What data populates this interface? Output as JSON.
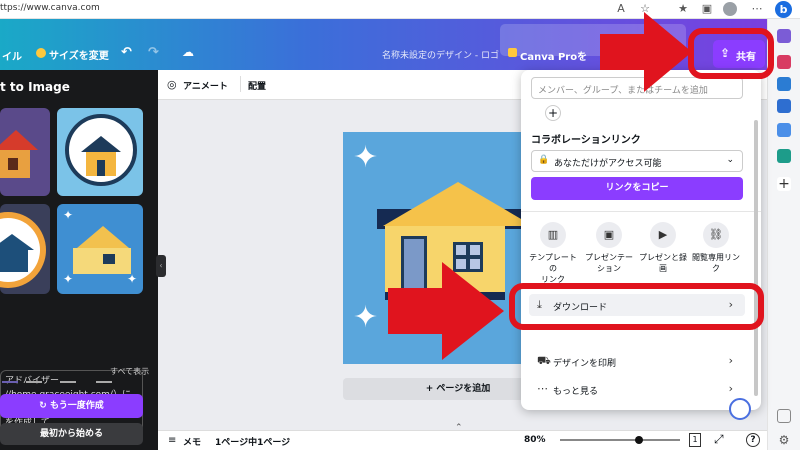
{
  "browser": {
    "url": "ttps://www.canva.com"
  },
  "header": {
    "file_label": "イル",
    "resize_label": "サイズを変更",
    "doc_title": "名称未設定のデザイン - ロゴ",
    "canva_pro_label": "Canva Proを",
    "share_label": "共有"
  },
  "left_panel": {
    "title": "t to Image",
    "advisor_text_1": "アドバイザー",
    "advisor_text_2": "//home.graceeight.com/）に合うア",
    "advisor_text_3": "を作成して",
    "show_all": "すべて表示",
    "regenerate": "もう一度作成",
    "restart": "最初から始める"
  },
  "toolbar": {
    "animate": "アニメート",
    "position": "配置"
  },
  "canvas": {
    "add_page": "+ ページを追加"
  },
  "bottom": {
    "notes": "メモ",
    "page_info": "1ページ中1ページ",
    "zoom": "80%",
    "zoom_fraction": 0.8,
    "page_badge": "1",
    "help": "?"
  },
  "share_popup": {
    "member_placeholder": "メンバー、グループ、またはチームを追加",
    "collab_label": "コラボレーションリンク",
    "access_value": "あなただけがアクセス可能",
    "copy_link": "リンクをコピー",
    "options": [
      {
        "label1": "テンプレートの",
        "label2": "リンク",
        "icon": "template-icon"
      },
      {
        "label1": "プレゼンテーション",
        "label2": "",
        "icon": "present-icon"
      },
      {
        "label1": "プレゼンと録画",
        "label2": "",
        "icon": "record-icon"
      },
      {
        "label1": "閲覧専用リンク",
        "label2": "",
        "icon": "link-icon"
      }
    ],
    "download": "ダウンロード",
    "print": "デザインを印刷",
    "more": "もっと見る"
  },
  "colors": {
    "accent": "#8b3dff",
    "annotation": "#e0141e"
  }
}
